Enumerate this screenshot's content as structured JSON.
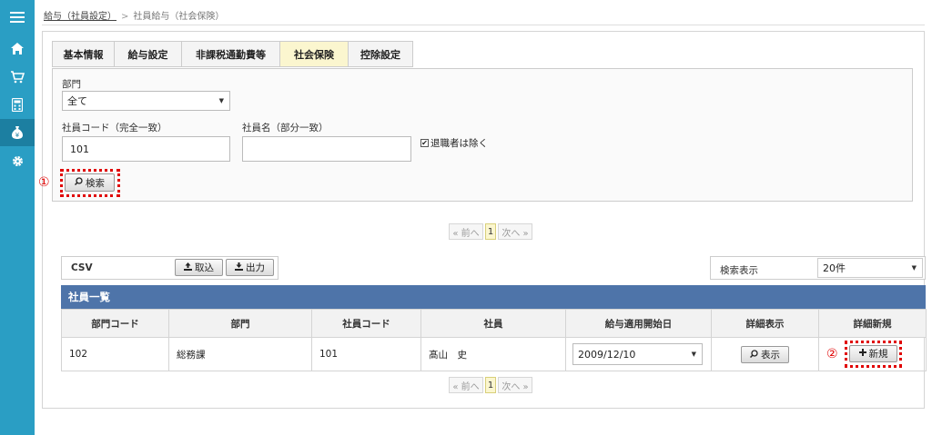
{
  "sidebar": {
    "icons": [
      "menu-icon",
      "home-icon",
      "cart-icon",
      "calculator-icon",
      "money-bag-icon",
      "gear-icon"
    ]
  },
  "breadcrumb": {
    "link": "給与（社員設定）",
    "separator": ">",
    "current": "社員給与（社会保険）"
  },
  "tabs": [
    {
      "label": "基本情報",
      "active": false
    },
    {
      "label": "給与設定",
      "active": false
    },
    {
      "label": "非課税通勤費等",
      "active": false
    },
    {
      "label": "社会保険",
      "active": true
    },
    {
      "label": "控除設定",
      "active": false
    }
  ],
  "search": {
    "department_label": "部門",
    "department_value": "全て",
    "employee_code_label": "社員コード（完全一致）",
    "employee_code_value": "101",
    "employee_name_label": "社員名（部分一致）",
    "employee_name_value": "",
    "exclude_retired_label": "退職者は除く",
    "exclude_retired_checked": true,
    "search_button": "検索"
  },
  "markers": {
    "m1": "①",
    "m2": "②"
  },
  "pagination": {
    "prev": "« 前へ",
    "page": "1",
    "next": "次へ »"
  },
  "csv": {
    "label": "CSV",
    "import_button": "取込",
    "export_button": "出力"
  },
  "display": {
    "label": "検索表示",
    "value": "20件"
  },
  "employee_list": {
    "title": "社員一覧",
    "columns": [
      "部門コード",
      "部門",
      "社員コード",
      "社員",
      "給与適用開始日",
      "詳細表示",
      "詳細新規"
    ],
    "rows": [
      {
        "dept_code": "102",
        "dept": "総務課",
        "emp_code": "101",
        "emp_name": "髙山　史",
        "start_date": "2009/12/10",
        "view_button": "表示",
        "new_button": "新規"
      }
    ]
  }
}
